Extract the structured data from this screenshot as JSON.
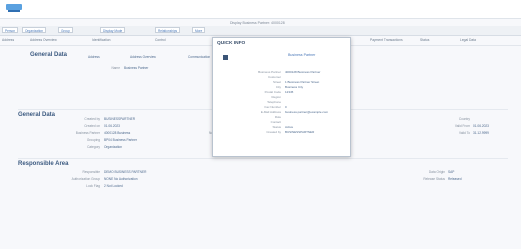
{
  "header": {
    "center_text": "Display Business Partner: 4000128"
  },
  "toolbar": {
    "buttons": [
      "Person",
      "Organization",
      "Group",
      "Display Mode",
      "Relationships",
      "More"
    ]
  },
  "tabs": [
    "Address",
    "Address Overview",
    "Identification",
    "Control",
    "Payment Transactions",
    "Status",
    "Legal Data"
  ],
  "general": {
    "title": "General Data",
    "subtabs": [
      "Address",
      "Address Overview",
      "Communication"
    ],
    "name_label": "Name",
    "name_value": "Business Partner"
  },
  "general2": {
    "title": "General Data",
    "rows": [
      {
        "label": "Created by",
        "value": "BUSINESSPARTNER"
      },
      {
        "label": "Created on",
        "value": "01.06.2023"
      },
      {
        "label": "Business Partner",
        "value": "4000128 Business"
      },
      {
        "label": "Grouping",
        "value": "BP04 Business Partner"
      },
      {
        "label": "Category",
        "value": "Organization"
      }
    ],
    "middle": "Not relevant",
    "right_rows": [
      {
        "label": "Country",
        "value": ""
      },
      {
        "label": "Valid From",
        "value": "01.06.2023"
      },
      {
        "label": "Valid To",
        "value": "31.12.9999"
      }
    ]
  },
  "responsible": {
    "title": "Responsible Area",
    "rows": [
      {
        "label": "Responsible",
        "value": "DEMO  BUSINESS PARTNER"
      },
      {
        "label": "Authorization Group",
        "value": "NONE  No Authorization"
      },
      {
        "label": "Lock Flag",
        "value": "2  Not Locked"
      }
    ],
    "right": [
      {
        "label": "Data Origin",
        "value": "SAP"
      },
      {
        "label": "Release Status",
        "value": "Released"
      }
    ]
  },
  "popup": {
    "title": "QUICK INFO",
    "subtitle": "Business Partner",
    "rows": [
      {
        "label": "Business Partner",
        "value": "4000128 Business Partner"
      },
      {
        "label": "Customer",
        "value": ""
      },
      {
        "label": "Street",
        "value": "1 Business Partner Street"
      },
      {
        "label": "City",
        "value": "Business City"
      },
      {
        "label": "Postal Code",
        "value": "12345"
      },
      {
        "label": "Region",
        "value": ""
      },
      {
        "label": "Telephone",
        "value": ""
      },
      {
        "label": "Fax Number",
        "value": "0"
      },
      {
        "label": "E-Mail Address",
        "value": "business.partner@example.com"
      },
      {
        "label": "Role",
        "value": ""
      },
      {
        "label": "Contact",
        "value": ""
      },
      {
        "label": "Status",
        "value": "Active"
      },
      {
        "label": "Created by",
        "value": "BUSINESSPARTNER"
      }
    ]
  },
  "colors": {
    "accent": "#4a78b8",
    "logo": "#5aa1e0"
  }
}
